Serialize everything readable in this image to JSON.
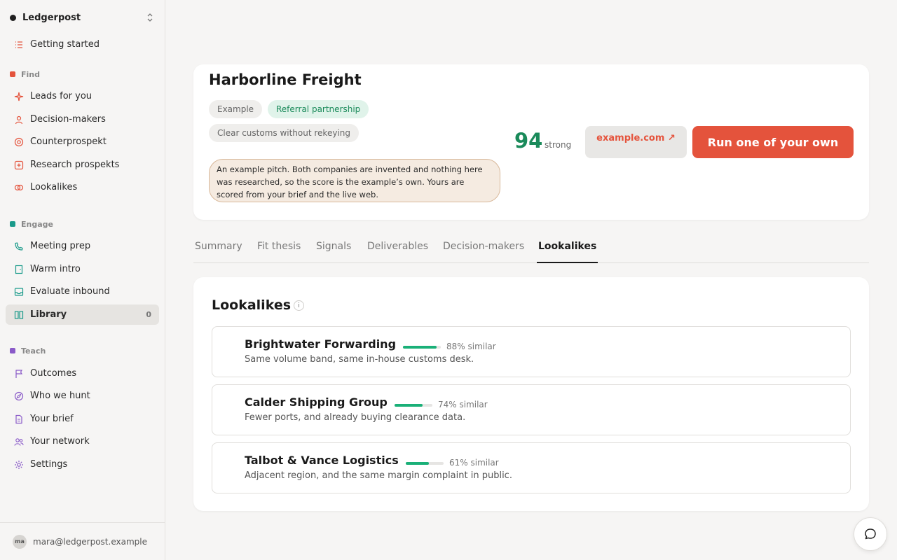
{
  "workspace": {
    "name": "Ledgerpost"
  },
  "sidebar": {
    "getting_started": "Getting started",
    "sections": [
      {
        "label": "Find",
        "color": "#e4533c"
      },
      {
        "label": "Engage",
        "color": "#1a9a8a"
      },
      {
        "label": "Teach",
        "color": "#8a5ac8"
      }
    ],
    "find_items": [
      "Leads for you",
      "Decision-makers",
      "Counterprospekt",
      "Research prospekts",
      "Lookalikes"
    ],
    "engage_items": [
      "Meeting prep",
      "Warm intro",
      "Evaluate inbound",
      "Library"
    ],
    "library_count": "0",
    "teach_items": [
      "Outcomes",
      "Who we hunt",
      "Your brief",
      "Your network",
      "Settings"
    ],
    "user": {
      "initials": "ma",
      "email": "mara@ledgerpost.example"
    }
  },
  "header": {
    "company": "Harborline Freight",
    "tags": [
      "Example",
      "Referral partnership",
      "Clear customs without rekeying"
    ],
    "pitch": "An example pitch. Both companies are invented and nothing here was researched, so the score is the example’s own. Yours are scored from your brief and the live web.",
    "score": "94",
    "score_label": "strong",
    "domain": "example.com ↗",
    "cta": "Run one of your own"
  },
  "tabs": [
    "Summary",
    "Fit thesis",
    "Signals",
    "Deliverables",
    "Decision-makers",
    "Lookalikes"
  ],
  "active_tab": "Lookalikes",
  "lookalikes": {
    "title": "Lookalikes",
    "info": "i",
    "rows": [
      {
        "name": "Brightwater Forwarding",
        "similarity": 0.88,
        "similar_label": "88% similar",
        "desc": "Same volume band, same in-house customs desk."
      },
      {
        "name": "Calder Shipping Group",
        "similarity": 0.74,
        "similar_label": "74% similar",
        "desc": "Fewer ports, and already buying clearance data."
      },
      {
        "name": "Talbot & Vance Logistics",
        "similarity": 0.61,
        "similar_label": "61% similar",
        "desc": "Adjacent region, and the same margin complaint in public."
      }
    ]
  },
  "icons": {
    "getting_started": "list-icon",
    "leads": "sparkle-icon",
    "decision_makers": "person-icon",
    "counterprospekt": "target-icon",
    "research": "plus-box-icon",
    "lookalikes": "overlap-circles-icon",
    "meeting_prep": "phone-icon",
    "warm_intro": "door-icon",
    "evaluate_inbound": "inbox-icon",
    "library": "book-icon",
    "outcomes": "flag-icon",
    "who_we_hunt": "compass-icon",
    "your_brief": "document-icon",
    "your_network": "people-icon",
    "settings": "gear-icon",
    "chat": "chat-bubble-icon"
  }
}
